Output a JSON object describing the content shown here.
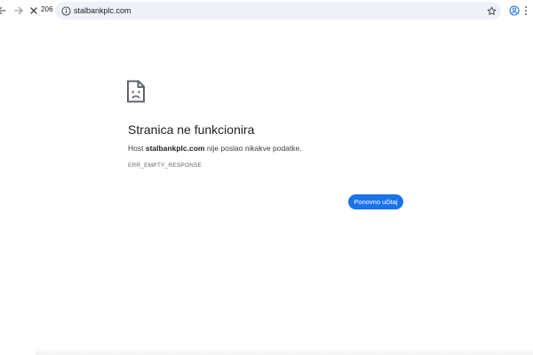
{
  "toolbar": {
    "back_icon": "arrow-left-icon",
    "forward_icon": "arrow-right-icon",
    "stop_icon": "close-icon",
    "tab_count": "206",
    "url": "stalbankplc.com",
    "info_icon": "info-icon",
    "bookmark_icon": "star-icon",
    "profile_icon": "account-circle-icon",
    "menu_icon": "more-vertical-icon"
  },
  "error": {
    "icon": "sad-page-icon",
    "title": "Stranica ne funkcionira",
    "message_prefix": "Host ",
    "host": "stalbankplc.com",
    "message_suffix": " nije poslao nikakve podatke.",
    "code": "ERR_EMPTY_RESPONSE",
    "reload_label": "Ponovno učitaj"
  },
  "colors": {
    "accent": "#1a73e8",
    "omnibox_bg": "#eef1f8",
    "text": "#202124",
    "muted": "#5f6368"
  }
}
